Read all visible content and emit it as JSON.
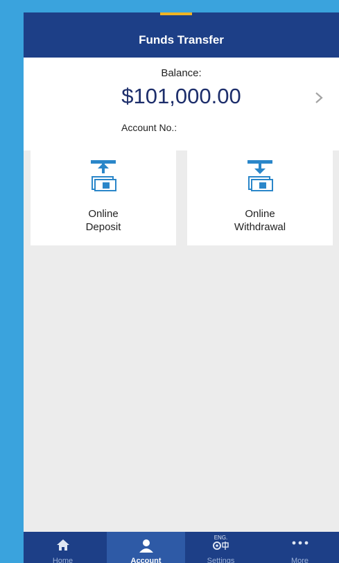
{
  "header": {
    "title": "Funds Transfer"
  },
  "balance": {
    "label": "Balance:",
    "amount": "$101,000.00",
    "account_label": "Account No.:"
  },
  "actions": [
    {
      "label_line1": "Online",
      "label_line2": "Deposit",
      "icon": "deposit-icon"
    },
    {
      "label_line1": "Online",
      "label_line2": "Withdrawal",
      "icon": "withdrawal-icon"
    }
  ],
  "tabbar": {
    "items": [
      {
        "label": "Home",
        "icon": "home-icon"
      },
      {
        "label": "Account",
        "icon": "account-icon",
        "active": true
      },
      {
        "label": "Settings",
        "icon": "settings-icon",
        "badge": "ENG."
      },
      {
        "label": "More",
        "icon": "more-icon"
      }
    ]
  },
  "colors": {
    "header": "#1d3f87",
    "accent": "#f0b323",
    "amount": "#1d2e6b",
    "icon": "#2a86c9"
  }
}
